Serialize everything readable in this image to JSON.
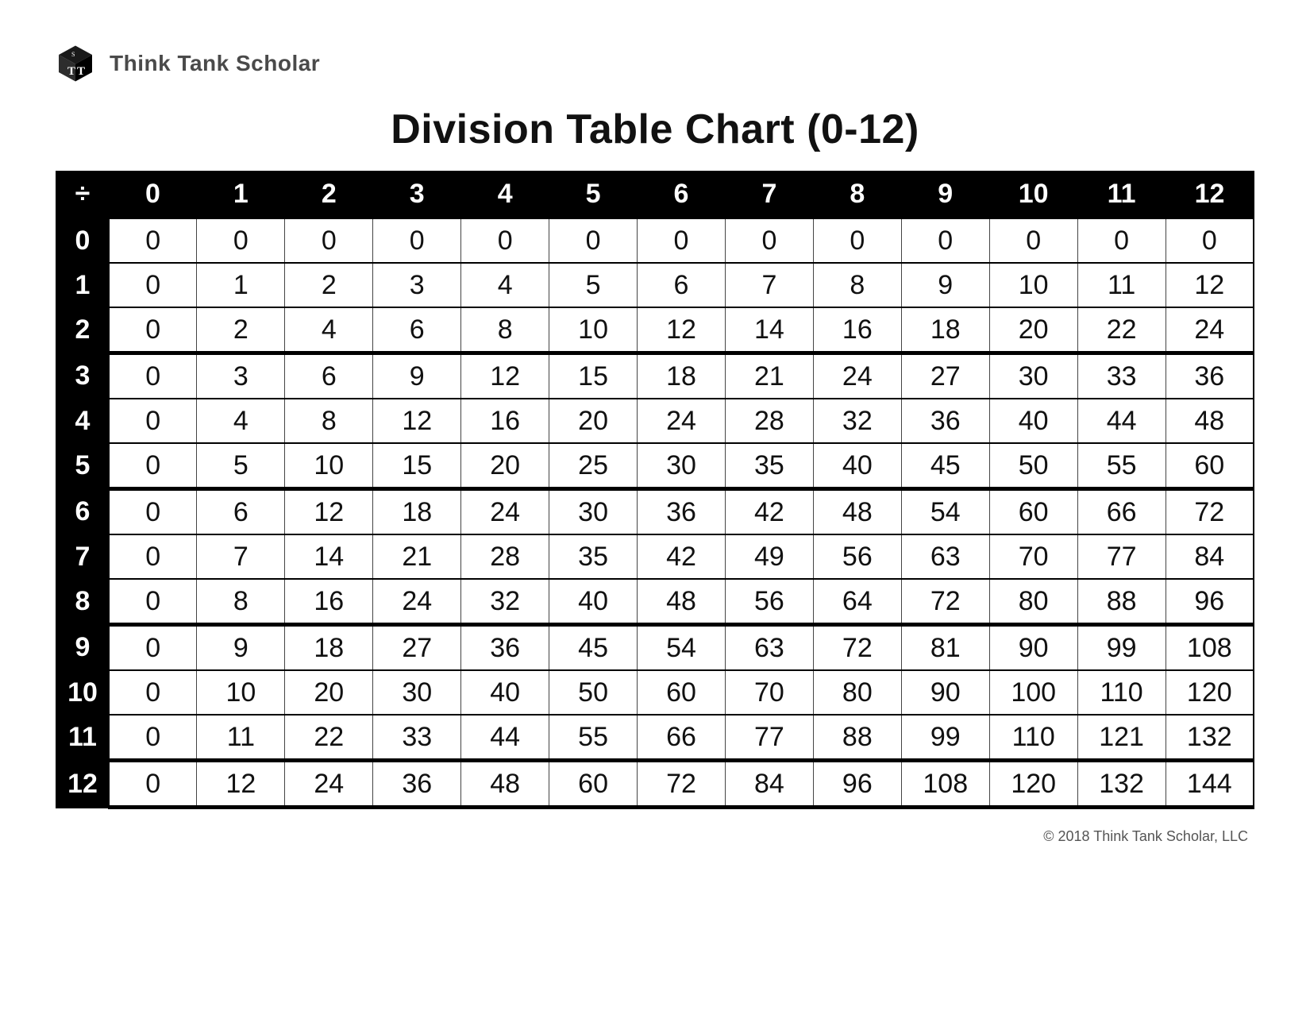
{
  "brand": {
    "name": "Think Tank Scholar",
    "logo_letters": "TT"
  },
  "title": "Division Table Chart (0-12)",
  "corner_symbol": "÷",
  "col_headers": [
    "0",
    "1",
    "2",
    "3",
    "4",
    "5",
    "6",
    "7",
    "8",
    "9",
    "10",
    "11",
    "12"
  ],
  "row_headers": [
    "0",
    "1",
    "2",
    "3",
    "4",
    "5",
    "6",
    "7",
    "8",
    "9",
    "10",
    "11",
    "12"
  ],
  "cells": [
    [
      "0",
      "0",
      "0",
      "0",
      "0",
      "0",
      "0",
      "0",
      "0",
      "0",
      "0",
      "0",
      "0"
    ],
    [
      "0",
      "1",
      "2",
      "3",
      "4",
      "5",
      "6",
      "7",
      "8",
      "9",
      "10",
      "11",
      "12"
    ],
    [
      "0",
      "2",
      "4",
      "6",
      "8",
      "10",
      "12",
      "14",
      "16",
      "18",
      "20",
      "22",
      "24"
    ],
    [
      "0",
      "3",
      "6",
      "9",
      "12",
      "15",
      "18",
      "21",
      "24",
      "27",
      "30",
      "33",
      "36"
    ],
    [
      "0",
      "4",
      "8",
      "12",
      "16",
      "20",
      "24",
      "28",
      "32",
      "36",
      "40",
      "44",
      "48"
    ],
    [
      "0",
      "5",
      "10",
      "15",
      "20",
      "25",
      "30",
      "35",
      "40",
      "45",
      "50",
      "55",
      "60"
    ],
    [
      "0",
      "6",
      "12",
      "18",
      "24",
      "30",
      "36",
      "42",
      "48",
      "54",
      "60",
      "66",
      "72"
    ],
    [
      "0",
      "7",
      "14",
      "21",
      "28",
      "35",
      "42",
      "49",
      "56",
      "63",
      "70",
      "77",
      "84"
    ],
    [
      "0",
      "8",
      "16",
      "24",
      "32",
      "40",
      "48",
      "56",
      "64",
      "72",
      "80",
      "88",
      "96"
    ],
    [
      "0",
      "9",
      "18",
      "27",
      "36",
      "45",
      "54",
      "63",
      "72",
      "81",
      "90",
      "99",
      "108"
    ],
    [
      "0",
      "10",
      "20",
      "30",
      "40",
      "50",
      "60",
      "70",
      "80",
      "90",
      "100",
      "110",
      "120"
    ],
    [
      "0",
      "11",
      "22",
      "33",
      "44",
      "55",
      "66",
      "77",
      "88",
      "99",
      "110",
      "121",
      "132"
    ],
    [
      "0",
      "12",
      "24",
      "36",
      "48",
      "60",
      "72",
      "84",
      "96",
      "108",
      "120",
      "132",
      "144"
    ]
  ],
  "copyright": "© 2018 Think Tank Scholar, LLC"
}
